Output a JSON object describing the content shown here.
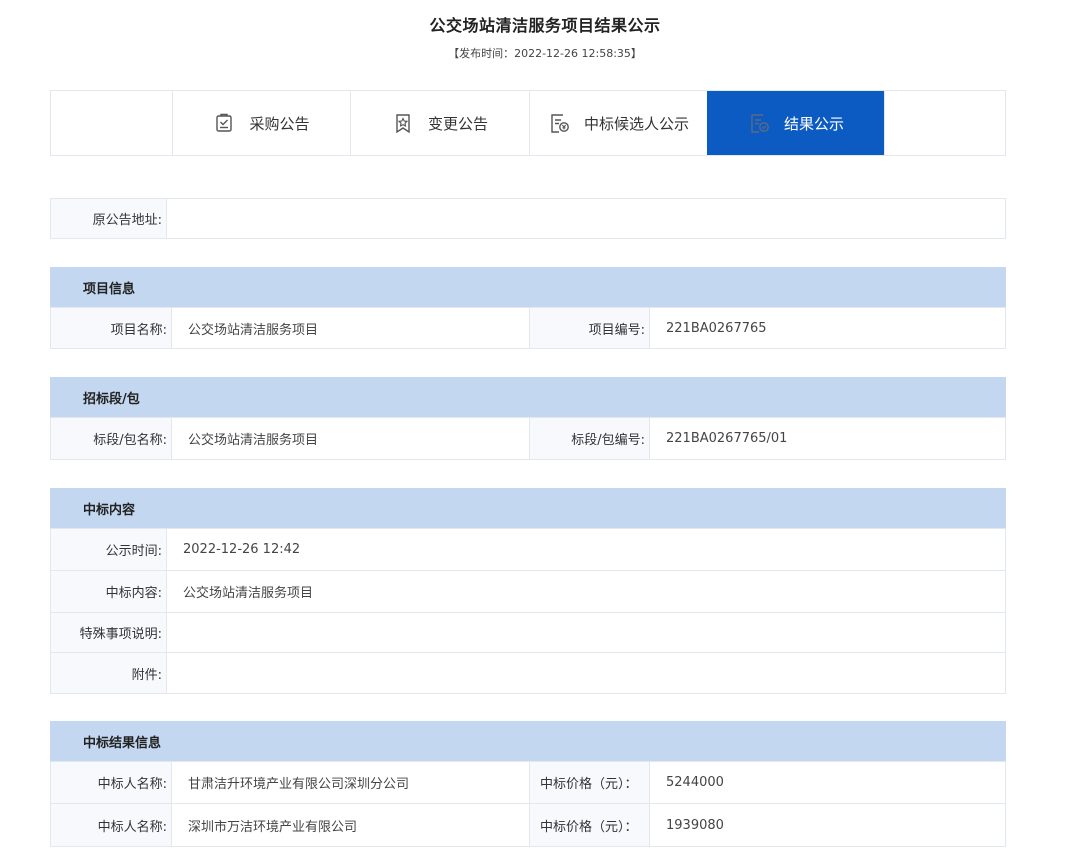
{
  "title": "公交场站清洁服务项目结果公示",
  "publish_time": "【发布时间：2022-12-26 12:58:35】",
  "tabs": [
    {
      "label": "采购公告",
      "icon": "purchase-notice-icon"
    },
    {
      "label": "变更公告",
      "icon": "change-notice-icon"
    },
    {
      "label": "中标候选人公示",
      "icon": "candidate-notice-icon"
    },
    {
      "label": "结果公示",
      "icon": "result-notice-icon",
      "active": true
    }
  ],
  "colors": {
    "active_tab": "#0c5bc2",
    "section_header": "#c3d8f0",
    "label_bg": "#f7f9fc"
  },
  "original_url": {
    "label": "原公告地址:",
    "value": ""
  },
  "project_info": {
    "header": "项目信息",
    "name_label": "项目名称:",
    "name_value": "公交场站清洁服务项目",
    "code_label": "项目编号:",
    "code_value": "221BA0267765"
  },
  "package": {
    "header": "招标段/包",
    "name_label": "标段/包名称:",
    "name_value": "公交场站清洁服务项目",
    "code_label": "标段/包编号:",
    "code_value": "221BA0267765/01"
  },
  "award_content": {
    "header": "中标内容",
    "rows": [
      {
        "label": "公示时间:",
        "value": "2022-12-26 12:42"
      },
      {
        "label": "中标内容:",
        "value": "公交场站清洁服务项目"
      },
      {
        "label": "特殊事项说明:",
        "value": ""
      },
      {
        "label": "附件:",
        "value": ""
      }
    ]
  },
  "award_result": {
    "header": "中标结果信息",
    "rows": [
      {
        "winner_label": "中标人名称:",
        "winner_value": "甘肃洁升环境产业有限公司深圳分公司",
        "price_label": "中标价格（元）：",
        "price_value": "5244000"
      },
      {
        "winner_label": "中标人名称:",
        "winner_value": "深圳市万洁环境产业有限公司",
        "price_label": "中标价格（元）：",
        "price_value": "1939080"
      }
    ]
  }
}
